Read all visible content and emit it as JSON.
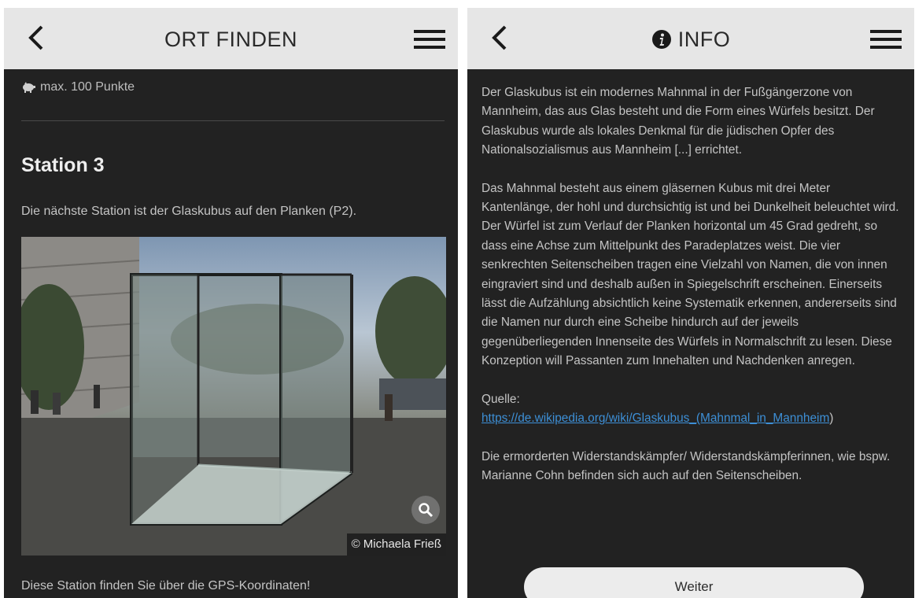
{
  "left_screen": {
    "header": {
      "title": "ORT FINDEN"
    },
    "points": {
      "icon": "piggy-bank-icon",
      "label": "max. 100 Punkte"
    },
    "station": {
      "title": "Station 3",
      "description": "Die nächste Station ist der Glaskubus auf den Planken (P2).",
      "photo_credit": "© Michaela Frieß",
      "gps_text": "Diese Station finden Sie über die GPS-Koordinaten!"
    }
  },
  "right_screen": {
    "header": {
      "title": "INFO",
      "icon": "info-icon"
    },
    "paragraphs": [
      "Der Glaskubus ist ein modernes Mahnmal in der Fußgängerzone von Mannheim, das aus Glas besteht und die Form eines Würfels besitzt. Der Glaskubus wurde als lokales Denkmal für die jüdischen Opfer des Nationalsozialismus aus Mannheim [...] errichtet.",
      "Das Mahnmal besteht aus einem gläsernen Kubus mit drei Meter Kantenlänge, der hohl und durchsichtig ist und bei Dunkelheit beleuchtet wird. Der Würfel ist zum Verlauf der Planken horizontal um 45 Grad gedreht, so dass eine Achse zum Mittelpunkt des Paradeplatzes weist. Die vier senkrechten Seitenscheiben tragen eine Vielzahl von Namen, die von innen eingraviert sind und deshalb außen in Spiegelschrift erscheinen. Einerseits lässt die Aufzählung absichtlich keine Systematik erkennen, andererseits sind die Namen nur durch eine Scheibe hindurch auf der jeweils gegenüberliegenden Innenseite des Würfels in Normalschrift zu lesen. Diese Konzeption will Passanten zum Innehalten und Nachdenken anregen."
    ],
    "source": {
      "label": "Quelle:",
      "link_text": "https://de.wikipedia.org/wiki/Glaskubus_(Mahnmal_in_Mannheim",
      "closing": ")"
    },
    "closing_paragraph": "Die ermorderten Widerstandskämpfer/ Widerstandskämpferinnen, wie bspw. Marianne Cohn befinden sich auch auf den Seitenscheiben.",
    "next_button": "Weiter"
  },
  "colors": {
    "background": "#222222",
    "header": "#e6e6e6",
    "text": "#c4c4c4",
    "link": "#3d8fd6",
    "button": "#ececec"
  }
}
